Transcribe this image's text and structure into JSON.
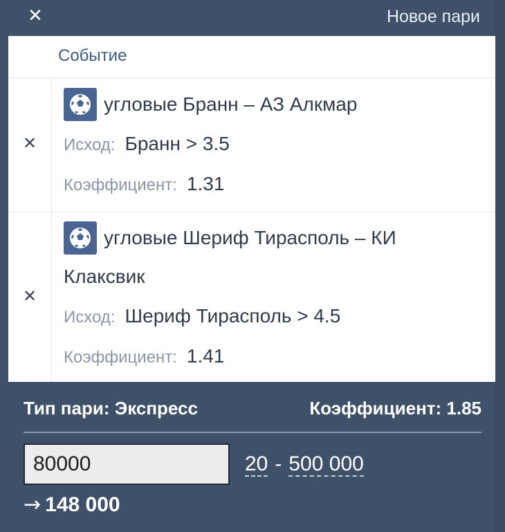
{
  "header": {
    "close_icon": "close-icon",
    "title": "Новое пари"
  },
  "table": {
    "column_event": "Событие"
  },
  "bets": [
    {
      "sport_icon": "soccer-ball-icon",
      "event": "угловые Бранн – АЗ Алкмар",
      "outcome_label": "Исход:",
      "outcome_value": "Бранн >  3.5",
      "coef_label": "Коэффициент:",
      "coef_value": "1.31"
    },
    {
      "sport_icon": "soccer-ball-icon",
      "event_line1": "угловые Шериф Тирасполь – КИ",
      "event_line2": "Клаксвик",
      "outcome_label": "Исход:",
      "outcome_value": "Шериф Тирасполь >  4.5",
      "coef_label": "Коэффициент:",
      "coef_value": "1.41"
    }
  ],
  "footer": {
    "bet_type": "Тип пари: Экспресс",
    "total_coef": "Коэффициент: 1.85",
    "stake_value": "80000",
    "min_stake": "20",
    "separator": "-",
    "max_stake": "500 000",
    "payout_arrow": "→",
    "payout": "148 000"
  },
  "colors": {
    "background": "#3f5169",
    "panel": "#ffffff",
    "icon_bg": "#4a6592"
  }
}
